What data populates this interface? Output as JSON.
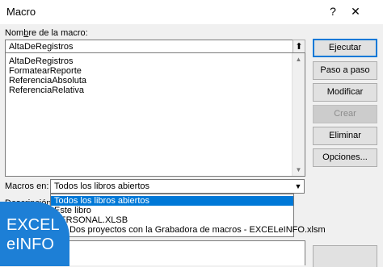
{
  "window": {
    "title": "Macro",
    "help_label": "?",
    "close_label": "✕"
  },
  "macro_name": {
    "label_prefix": "Nom",
    "label_underlined": "b",
    "label_suffix": "re de la macro:",
    "value": "AltaDeRegistros",
    "upload_icon": "⬆"
  },
  "macro_list": {
    "items": [
      "AltaDeRegistros",
      "FormatearReporte",
      "ReferenciaAbsoluta",
      "ReferenciaRelativa"
    ],
    "scroll_up": "▲",
    "scroll_down": "▼"
  },
  "buttons": {
    "run": "Ejecutar",
    "step": "Paso a paso",
    "edit": "Modificar",
    "create": "Crear",
    "delete": "Eliminar",
    "options": "Opciones..."
  },
  "macros_in": {
    "label": "Macros en:",
    "selected": "Todos los libros abiertos",
    "arrow": "▼",
    "options": [
      "Todos los libros abiertos",
      "Este libro",
      "PERSONAL.XLSB",
      "... - Dos proyectos con la Grabadora de macros - EXCELeINFO.xlsm"
    ]
  },
  "description": {
    "label": "Descripción"
  },
  "logo": {
    "line1": "EXCEL",
    "line2": "eINFO"
  },
  "colors": {
    "accent": "#0078d7",
    "logo": "#1d7fd6"
  }
}
